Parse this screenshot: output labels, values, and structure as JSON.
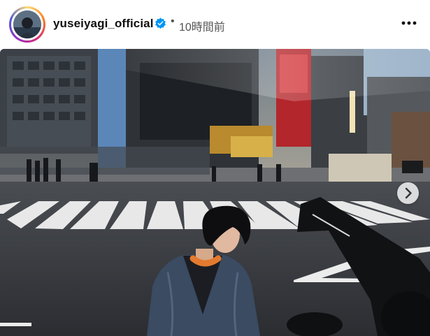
{
  "post": {
    "username": "yuseiyagi_official",
    "verified": true,
    "separator": "•",
    "time_ago": "10時間前",
    "more_icon": "more-horizontal-icon",
    "next_icon": "chevron-right-icon"
  },
  "colors": {
    "verified_blue": "#0095f6",
    "text": "#111111",
    "muted": "#555555"
  }
}
